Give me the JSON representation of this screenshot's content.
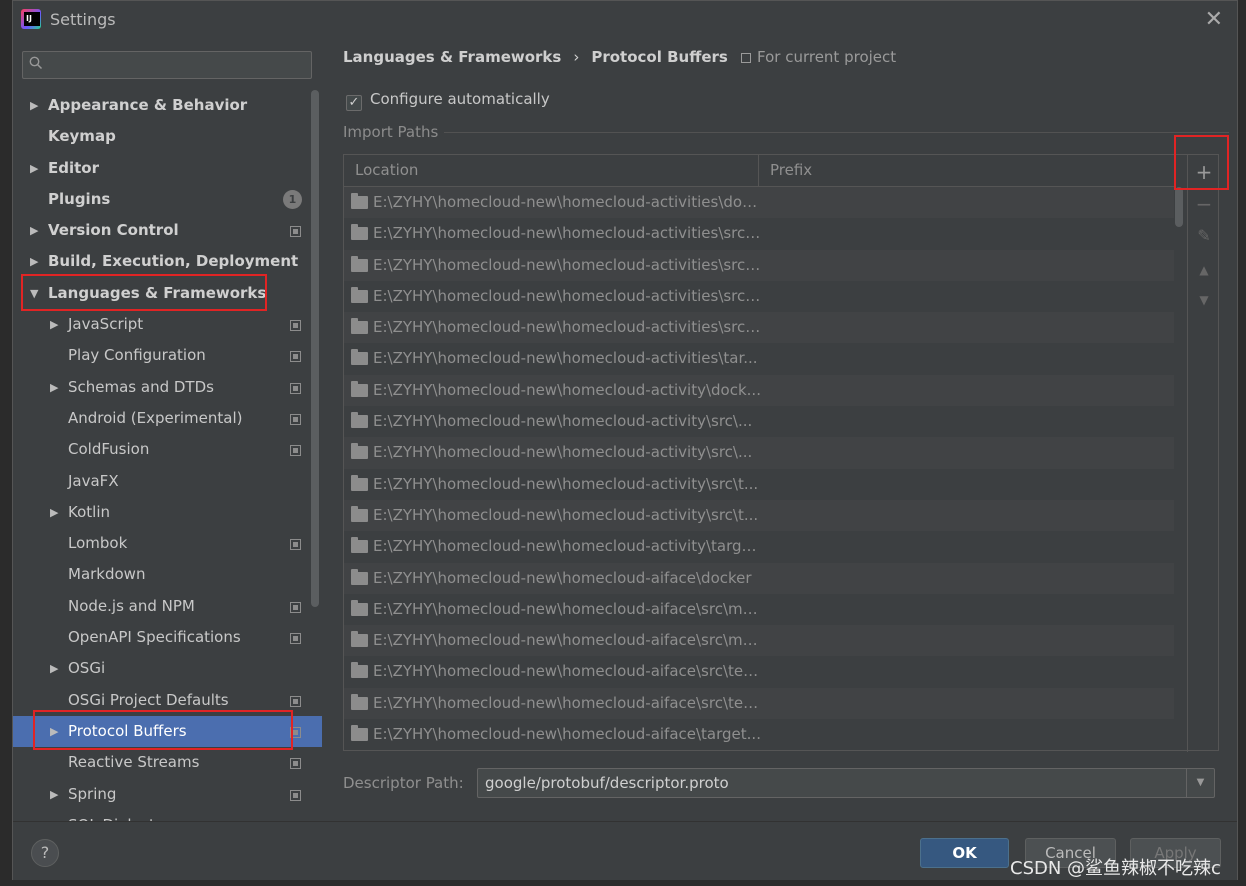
{
  "window": {
    "title": "Settings",
    "close_glyph": "✕"
  },
  "search": {
    "placeholder": "",
    "icon": "search-icon"
  },
  "sidebar": {
    "items": [
      {
        "label": "Appearance & Behavior",
        "level": 0,
        "expandable": true,
        "expanded": false,
        "project": false
      },
      {
        "label": "Keymap",
        "level": 0,
        "expandable": false,
        "project": false
      },
      {
        "label": "Editor",
        "level": 0,
        "expandable": true,
        "expanded": false,
        "project": false
      },
      {
        "label": "Plugins",
        "level": 0,
        "expandable": false,
        "project": false,
        "badge": "1"
      },
      {
        "label": "Version Control",
        "level": 0,
        "expandable": true,
        "expanded": false,
        "project": true
      },
      {
        "label": "Build, Execution, Deployment",
        "level": 0,
        "expandable": true,
        "expanded": false,
        "project": false
      },
      {
        "label": "Languages & Frameworks",
        "level": 0,
        "expandable": true,
        "expanded": true,
        "project": false
      },
      {
        "label": "JavaScript",
        "level": 1,
        "expandable": true,
        "expanded": false,
        "project": true
      },
      {
        "label": "Play Configuration",
        "level": 1,
        "expandable": false,
        "project": true
      },
      {
        "label": "Schemas and DTDs",
        "level": 1,
        "expandable": true,
        "expanded": false,
        "project": true
      },
      {
        "label": "Android (Experimental)",
        "level": 1,
        "expandable": false,
        "project": true
      },
      {
        "label": "ColdFusion",
        "level": 1,
        "expandable": false,
        "project": true
      },
      {
        "label": "JavaFX",
        "level": 1,
        "expandable": false,
        "project": false
      },
      {
        "label": "Kotlin",
        "level": 1,
        "expandable": true,
        "expanded": false,
        "project": false
      },
      {
        "label": "Lombok",
        "level": 1,
        "expandable": false,
        "project": true
      },
      {
        "label": "Markdown",
        "level": 1,
        "expandable": false,
        "project": false
      },
      {
        "label": "Node.js and NPM",
        "level": 1,
        "expandable": false,
        "project": true
      },
      {
        "label": "OpenAPI Specifications",
        "level": 1,
        "expandable": false,
        "project": true
      },
      {
        "label": "OSGi",
        "level": 1,
        "expandable": true,
        "expanded": false,
        "project": false
      },
      {
        "label": "OSGi Project Defaults",
        "level": 1,
        "expandable": false,
        "project": true
      },
      {
        "label": "Protocol Buffers",
        "level": 1,
        "expandable": true,
        "expanded": false,
        "project": true,
        "selected": true
      },
      {
        "label": "Reactive Streams",
        "level": 1,
        "expandable": false,
        "project": true
      },
      {
        "label": "Spring",
        "level": 1,
        "expandable": true,
        "expanded": false,
        "project": true
      },
      {
        "label": "SQL Dialects",
        "level": 1,
        "expandable": false,
        "project": true
      }
    ]
  },
  "breadcrumb": {
    "parent": "Languages & Frameworks",
    "separator": "›",
    "current": "Protocol Buffers"
  },
  "scope": {
    "label": "For current project"
  },
  "configure": {
    "label": "Configure automatically",
    "checked": true,
    "check_glyph": "✓"
  },
  "import_paths": {
    "section_label": "Import Paths",
    "columns": [
      "Location",
      "Prefix"
    ],
    "rows": [
      "E:\\ZYHY\\homecloud-new\\homecloud-activities\\doc...",
      "E:\\ZYHY\\homecloud-new\\homecloud-activities\\src\\...",
      "E:\\ZYHY\\homecloud-new\\homecloud-activities\\src\\...",
      "E:\\ZYHY\\homecloud-new\\homecloud-activities\\src\\...",
      "E:\\ZYHY\\homecloud-new\\homecloud-activities\\src\\...",
      "E:\\ZYHY\\homecloud-new\\homecloud-activities\\tar...",
      "E:\\ZYHY\\homecloud-new\\homecloud-activity\\dock...",
      "E:\\ZYHY\\homecloud-new\\homecloud-activity\\src\\...",
      "E:\\ZYHY\\homecloud-new\\homecloud-activity\\src\\...",
      "E:\\ZYHY\\homecloud-new\\homecloud-activity\\src\\t...",
      "E:\\ZYHY\\homecloud-new\\homecloud-activity\\src\\t...",
      "E:\\ZYHY\\homecloud-new\\homecloud-activity\\targe...",
      "E:\\ZYHY\\homecloud-new\\homecloud-aiface\\docker",
      "E:\\ZYHY\\homecloud-new\\homecloud-aiface\\src\\ma...",
      "E:\\ZYHY\\homecloud-new\\homecloud-aiface\\src\\ma...",
      "E:\\ZYHY\\homecloud-new\\homecloud-aiface\\src\\tes...",
      "E:\\ZYHY\\homecloud-new\\homecloud-aiface\\src\\tes...",
      "E:\\ZYHY\\homecloud-new\\homecloud-aiface\\target..."
    ],
    "toolbar": {
      "add": "+",
      "remove": "−",
      "edit": "✎",
      "up": "▲",
      "down": "▼"
    }
  },
  "descriptor": {
    "label": "Descriptor Path:",
    "value": "google/protobuf/descriptor.proto",
    "dropdown_glyph": "▼"
  },
  "buttons": {
    "help": "?",
    "ok": "OK",
    "cancel": "Cancel",
    "apply": "Apply"
  },
  "watermark": "CSDN @鲨鱼辣椒不吃辣c",
  "colors": {
    "background": "#3c3f41",
    "selection": "#4b6eaf",
    "ok_button": "#365880",
    "highlight_box": "#e12424"
  }
}
